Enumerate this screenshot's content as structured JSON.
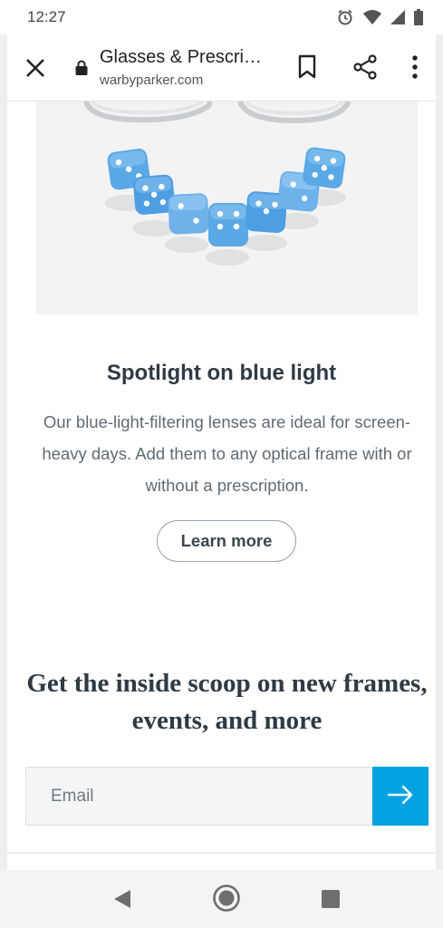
{
  "status_bar": {
    "time": "12:27",
    "icons": [
      "alarm-icon",
      "wifi-icon",
      "signal-icon",
      "battery-icon"
    ]
  },
  "app_bar": {
    "title": "Glasses & Prescri…",
    "url": "warbyparker.com",
    "icons": [
      "close-icon",
      "lock-icon",
      "bookmark-icon",
      "share-icon",
      "more-vert-icon"
    ]
  },
  "spotlight": {
    "title": "Spotlight on blue light",
    "body": "Our blue-light-filtering lenses are ideal for screen-heavy days. Add them to any optical frame with or without a prescription.",
    "button_label": "Learn more"
  },
  "newsletter": {
    "heading": "Get the inside scoop on new frames, events, and more",
    "email_placeholder": "Email",
    "email_value": "",
    "submit_icon": "arrow-right-icon"
  },
  "colors": {
    "accent": "#00a2e1",
    "heading": "#2f3a44",
    "body_text": "#5f6b75",
    "dice": "#5aa8e6"
  }
}
